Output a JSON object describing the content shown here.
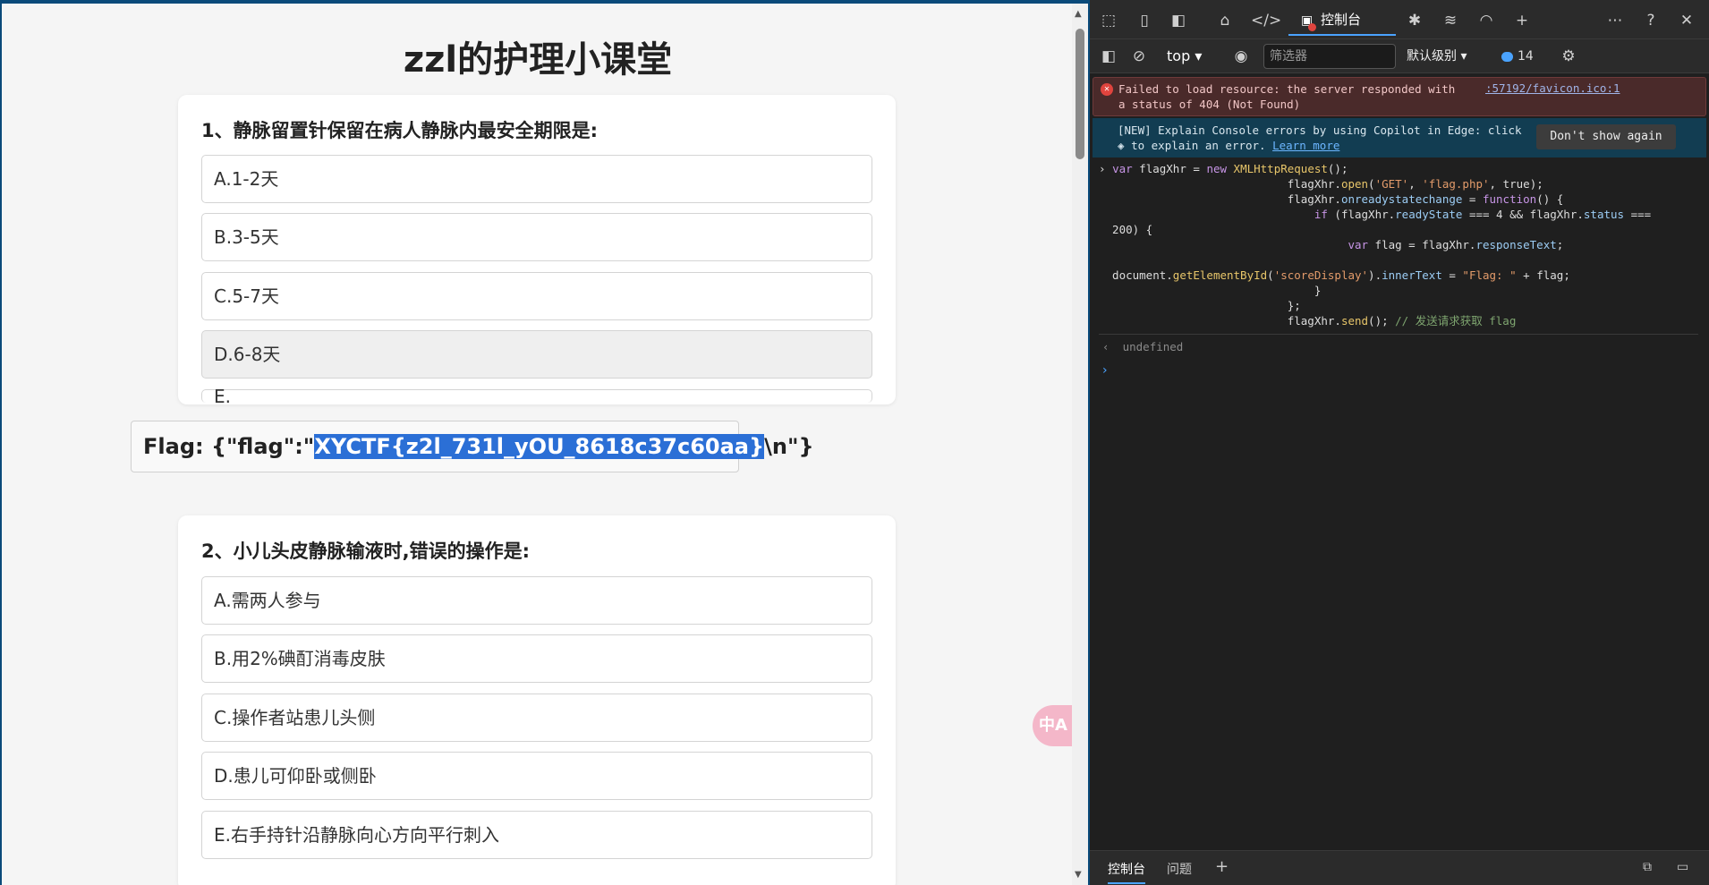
{
  "page": {
    "title": "zzl的护理小课堂",
    "questions": [
      {
        "title": "1、静脉留置针保留在病人静脉内最安全期限是:",
        "options": [
          "A.1-2天",
          "B.3-5天",
          "C.5-7天",
          "D.6-8天",
          "E."
        ]
      },
      {
        "title": "2、小儿头皮静脉输液时,错误的操作是:",
        "options": [
          "A.需两人参与",
          "B.用2%碘酊消毒皮肤",
          "C.操作者站患儿头侧",
          "D.患儿可仰卧或侧卧",
          "E.右手持针沿静脉向心方向平行刺入"
        ]
      }
    ],
    "selected_option": "D.6-8天",
    "flag_display": {
      "prefix": "Flag: {\"flag\":\"",
      "highlighted": "XYCTF{z2l_731l_yOU_8618c37c60aa}",
      "suffix": "\\n\"}"
    },
    "translate_icon": "translate-icon"
  },
  "devtools": {
    "tabs": {
      "console": "控制台"
    },
    "context": "top",
    "filter_placeholder": "筛选器",
    "level": "默认级别",
    "message_count": "14",
    "error": {
      "text": "Failed to load resource: the server responded with a status of 404 (Not Found)",
      "link": ":57192/favicon.ico:1"
    },
    "copilot": {
      "text": "[NEW] Explain Console errors by using Copilot in Edge: click",
      "text2": "to explain an error.",
      "learn_more": "Learn more",
      "dont_show": "Don't show again"
    },
    "result": "undefined",
    "bottom_tabs": {
      "console": "控制台",
      "issues": "问题"
    },
    "colors": {
      "accent": "#4aa3ff",
      "error_bg": "#4a2a2a",
      "copilot_bg": "#123d52"
    }
  }
}
